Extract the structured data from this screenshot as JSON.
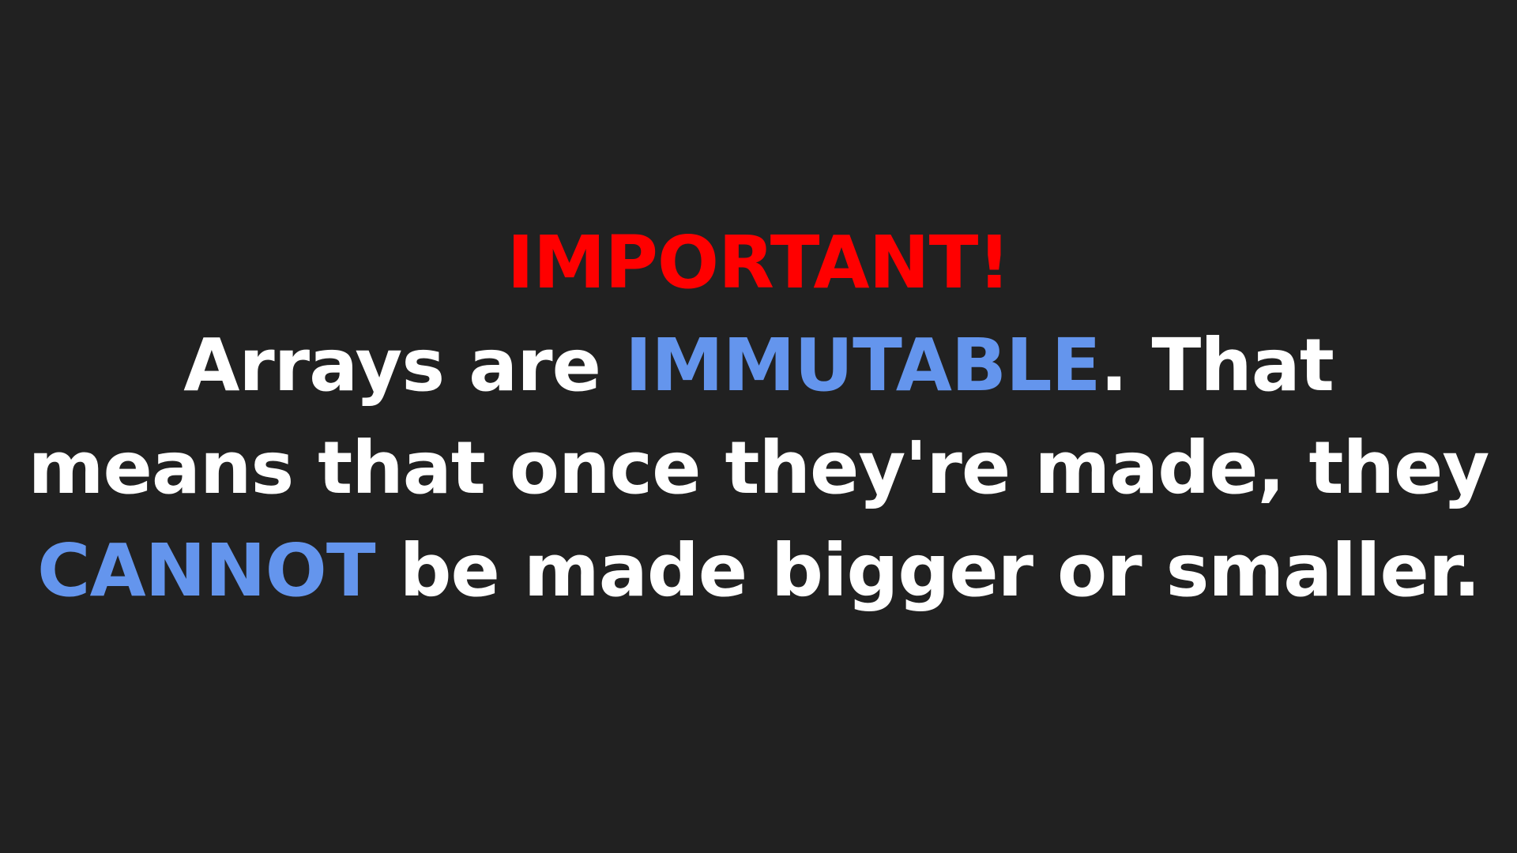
{
  "slide": {
    "heading": "IMPORTANT!",
    "line1": {
      "a": "Arrays are ",
      "highlight": "IMMUTABLE",
      "b": ". That"
    },
    "line2": "means that once they're made, they",
    "line3": {
      "highlight": "CANNOT",
      "rest": " be made bigger or smaller."
    }
  },
  "colors": {
    "background": "#212121",
    "heading": "#ff0000",
    "text": "#ffffff",
    "highlight": "#6495ed"
  }
}
